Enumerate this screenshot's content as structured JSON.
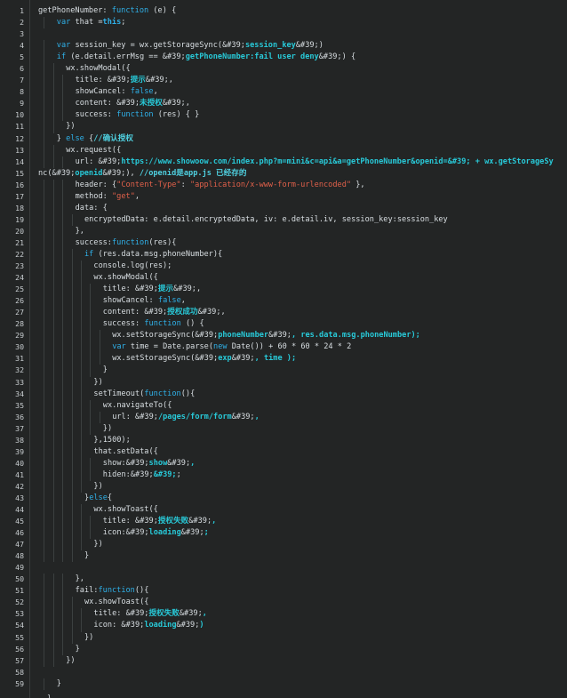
{
  "editor": {
    "theme_colors": {
      "background": "#232525",
      "keyword": "#2fb0e8",
      "string": "#28c9d8",
      "literal": "#e0604a",
      "text": "#d8dee2"
    },
    "lines": [
      {
        "n": "1",
        "indent": 0,
        "tokens": [
          [
            "t",
            "getPhoneNumber: "
          ],
          [
            "k",
            "function"
          ],
          [
            "t",
            " (e) {"
          ]
        ]
      },
      {
        "n": "2",
        "indent": 2,
        "tokens": [
          [
            "k",
            "var"
          ],
          [
            "t",
            " that ="
          ],
          [
            "kb",
            "this"
          ],
          [
            "t",
            ";"
          ]
        ]
      },
      {
        "n": "3",
        "indent": 0,
        "tokens": []
      },
      {
        "n": "4",
        "indent": 2,
        "tokens": [
          [
            "k",
            "var"
          ],
          [
            "t",
            " session_key = wx.getStorageSync(&#39;"
          ],
          [
            "s",
            "session_key"
          ],
          [
            "t",
            "&#39;)"
          ]
        ]
      },
      {
        "n": "5",
        "indent": 2,
        "tokens": [
          [
            "k",
            "if"
          ],
          [
            "t",
            " (e.detail.errMsg == &#39;"
          ],
          [
            "s",
            "getPhoneNumber:fail user deny"
          ],
          [
            "t",
            "&#39;) {"
          ]
        ]
      },
      {
        "n": "6",
        "indent": 3,
        "tokens": [
          [
            "t",
            "wx.showModal({"
          ]
        ]
      },
      {
        "n": "7",
        "indent": 4,
        "tokens": [
          [
            "t",
            "title: &#39;"
          ],
          [
            "s",
            "提示"
          ],
          [
            "t",
            "&#39;,"
          ]
        ]
      },
      {
        "n": "8",
        "indent": 4,
        "tokens": [
          [
            "t",
            "showCancel: "
          ],
          [
            "k",
            "false"
          ],
          [
            "t",
            ","
          ]
        ]
      },
      {
        "n": "9",
        "indent": 4,
        "tokens": [
          [
            "t",
            "content: &#39;"
          ],
          [
            "s",
            "未授权"
          ],
          [
            "t",
            "&#39;,"
          ]
        ]
      },
      {
        "n": "10",
        "indent": 4,
        "tokens": [
          [
            "t",
            "success: "
          ],
          [
            "k",
            "function"
          ],
          [
            "t",
            " (res) { }"
          ]
        ]
      },
      {
        "n": "11",
        "indent": 3,
        "tokens": [
          [
            "t",
            "})"
          ]
        ]
      },
      {
        "n": "12",
        "indent": 2,
        "tokens": [
          [
            "t",
            "} "
          ],
          [
            "k",
            "else"
          ],
          [
            "t",
            " {"
          ],
          [
            "c",
            "//确认授权"
          ]
        ]
      },
      {
        "n": "13",
        "indent": 3,
        "tokens": [
          [
            "t",
            "wx.request({"
          ]
        ]
      },
      {
        "n": "14",
        "indent": 4,
        "tokens": [
          [
            "t",
            "url: &#39;"
          ],
          [
            "s",
            "https://www.showoow.com/index.php?m=mini&c=api&a=getPhoneNumber&openid=&#39; + wx.getStorageSy"
          ]
        ]
      },
      {
        "n": "15",
        "indent": 0,
        "tokens": [
          [
            "t",
            "nc(&#39;"
          ],
          [
            "s",
            "openid"
          ],
          [
            "t",
            "&#39;), "
          ],
          [
            "c",
            "//openid是app.js 已经存的"
          ]
        ]
      },
      {
        "n": "16",
        "indent": 4,
        "tokens": [
          [
            "t",
            "header: {"
          ],
          [
            "r",
            "\"Content-Type\""
          ],
          [
            "t",
            ": "
          ],
          [
            "r",
            "\"application/x-www-form-urlencoded\""
          ],
          [
            "t",
            " },"
          ]
        ]
      },
      {
        "n": "17",
        "indent": 4,
        "tokens": [
          [
            "t",
            "method: "
          ],
          [
            "r",
            "\"get\""
          ],
          [
            "t",
            ","
          ]
        ]
      },
      {
        "n": "18",
        "indent": 4,
        "tokens": [
          [
            "t",
            "data: {"
          ]
        ]
      },
      {
        "n": "19",
        "indent": 5,
        "tokens": [
          [
            "t",
            "encryptedData: e.detail.encryptedData, iv: e.detail.iv, session_key:session_key"
          ]
        ]
      },
      {
        "n": "20",
        "indent": 4,
        "tokens": [
          [
            "t",
            "},"
          ]
        ]
      },
      {
        "n": "21",
        "indent": 4,
        "tokens": [
          [
            "t",
            "success:"
          ],
          [
            "k",
            "function"
          ],
          [
            "t",
            "(res){"
          ]
        ]
      },
      {
        "n": "22",
        "indent": 5,
        "tokens": [
          [
            "k",
            "if"
          ],
          [
            "t",
            " (res.data.msg.phoneNumber){"
          ]
        ]
      },
      {
        "n": "23",
        "indent": 6,
        "tokens": [
          [
            "t",
            "console.log(res);"
          ]
        ]
      },
      {
        "n": "24",
        "indent": 6,
        "tokens": [
          [
            "t",
            "wx.showModal({"
          ]
        ]
      },
      {
        "n": "25",
        "indent": 7,
        "tokens": [
          [
            "t",
            "title: &#39;"
          ],
          [
            "s",
            "提示"
          ],
          [
            "t",
            "&#39;,"
          ]
        ]
      },
      {
        "n": "26",
        "indent": 7,
        "tokens": [
          [
            "t",
            "showCancel: "
          ],
          [
            "k",
            "false"
          ],
          [
            "t",
            ","
          ]
        ]
      },
      {
        "n": "27",
        "indent": 7,
        "tokens": [
          [
            "t",
            "content: &#39;"
          ],
          [
            "s",
            "授权成功"
          ],
          [
            "t",
            "&#39;,"
          ]
        ]
      },
      {
        "n": "28",
        "indent": 7,
        "tokens": [
          [
            "t",
            "success: "
          ],
          [
            "k",
            "function"
          ],
          [
            "t",
            " () {"
          ]
        ]
      },
      {
        "n": "29",
        "indent": 8,
        "tokens": [
          [
            "t",
            "wx.setStorageSync(&#39;"
          ],
          [
            "s",
            "phoneNumber"
          ],
          [
            "t",
            "&#39;"
          ],
          [
            "s",
            ", res.data.msg.phoneNumber);"
          ]
        ]
      },
      {
        "n": "30",
        "indent": 8,
        "tokens": [
          [
            "k",
            "var"
          ],
          [
            "t",
            " time = Date.parse("
          ],
          [
            "k",
            "new"
          ],
          [
            "t",
            " Date()) + 60 * 60 * 24 * 2"
          ]
        ]
      },
      {
        "n": "31",
        "indent": 8,
        "tokens": [
          [
            "t",
            "wx.setStorageSync(&#39;"
          ],
          [
            "s",
            "exp"
          ],
          [
            "t",
            "&#39;"
          ],
          [
            "s",
            ", time );"
          ]
        ]
      },
      {
        "n": "32",
        "indent": 7,
        "tokens": [
          [
            "t",
            "}"
          ]
        ]
      },
      {
        "n": "33",
        "indent": 6,
        "tokens": [
          [
            "t",
            "})"
          ]
        ]
      },
      {
        "n": "34",
        "indent": 6,
        "tokens": [
          [
            "t",
            "setTimeout("
          ],
          [
            "k",
            "function"
          ],
          [
            "t",
            "(){"
          ]
        ]
      },
      {
        "n": "35",
        "indent": 7,
        "tokens": [
          [
            "t",
            "wx.navigateTo({"
          ]
        ]
      },
      {
        "n": "36",
        "indent": 8,
        "tokens": [
          [
            "t",
            "url: &#39;"
          ],
          [
            "s",
            "/pages/form/form"
          ],
          [
            "t",
            "&#39;"
          ],
          [
            "s",
            ","
          ]
        ]
      },
      {
        "n": "37",
        "indent": 7,
        "tokens": [
          [
            "t",
            "})"
          ]
        ]
      },
      {
        "n": "38",
        "indent": 6,
        "tokens": [
          [
            "t",
            "},1500);"
          ]
        ]
      },
      {
        "n": "39",
        "indent": 6,
        "tokens": [
          [
            "t",
            "that.setData({"
          ]
        ]
      },
      {
        "n": "40",
        "indent": 7,
        "tokens": [
          [
            "t",
            "show:&#39;"
          ],
          [
            "s",
            "show"
          ],
          [
            "t",
            "&#39;"
          ],
          [
            "s",
            ","
          ]
        ]
      },
      {
        "n": "41",
        "indent": 7,
        "tokens": [
          [
            "t",
            "hiden:&#39;"
          ],
          [
            "s",
            "&#39;"
          ],
          [
            "t",
            ";"
          ]
        ]
      },
      {
        "n": "42",
        "indent": 6,
        "tokens": [
          [
            "t",
            "})"
          ]
        ]
      },
      {
        "n": "43",
        "indent": 5,
        "tokens": [
          [
            "t",
            "}"
          ],
          [
            "k",
            "else"
          ],
          [
            "t",
            "{"
          ]
        ]
      },
      {
        "n": "44",
        "indent": 6,
        "tokens": [
          [
            "t",
            "wx.showToast({"
          ]
        ]
      },
      {
        "n": "45",
        "indent": 7,
        "tokens": [
          [
            "t",
            "title: &#39;"
          ],
          [
            "s",
            "授权失败"
          ],
          [
            "t",
            "&#39;"
          ],
          [
            "s",
            ","
          ]
        ]
      },
      {
        "n": "46",
        "indent": 7,
        "tokens": [
          [
            "t",
            "icon:&#39;"
          ],
          [
            "s",
            "loading"
          ],
          [
            "t",
            "&#39;"
          ],
          [
            "s",
            ";"
          ]
        ]
      },
      {
        "n": "47",
        "indent": 6,
        "tokens": [
          [
            "t",
            "})"
          ]
        ]
      },
      {
        "n": "48",
        "indent": 5,
        "tokens": [
          [
            "t",
            "}"
          ]
        ]
      },
      {
        "n": "49",
        "indent": 0,
        "tokens": []
      },
      {
        "n": "50",
        "indent": 4,
        "tokens": [
          [
            "t",
            "},"
          ]
        ]
      },
      {
        "n": "51",
        "indent": 4,
        "tokens": [
          [
            "t",
            "fail:"
          ],
          [
            "k",
            "function"
          ],
          [
            "t",
            "(){"
          ]
        ]
      },
      {
        "n": "52",
        "indent": 5,
        "tokens": [
          [
            "t",
            "wx.showToast({"
          ]
        ]
      },
      {
        "n": "53",
        "indent": 6,
        "tokens": [
          [
            "t",
            "title: &#39;"
          ],
          [
            "s",
            "授权失败"
          ],
          [
            "t",
            "&#39;"
          ],
          [
            "s",
            ","
          ]
        ]
      },
      {
        "n": "54",
        "indent": 6,
        "tokens": [
          [
            "t",
            "icon: &#39;"
          ],
          [
            "s",
            "loading"
          ],
          [
            "t",
            "&#39;"
          ],
          [
            "s",
            ")"
          ]
        ]
      },
      {
        "n": "55",
        "indent": 5,
        "tokens": [
          [
            "t",
            "})"
          ]
        ]
      },
      {
        "n": "56",
        "indent": 4,
        "tokens": [
          [
            "t",
            "}"
          ]
        ]
      },
      {
        "n": "57",
        "indent": 3,
        "tokens": [
          [
            "t",
            "})"
          ]
        ]
      },
      {
        "n": "58",
        "indent": 0,
        "tokens": []
      },
      {
        "n": "59",
        "indent": 2,
        "tokens": [
          [
            "t",
            "}"
          ]
        ]
      }
    ],
    "trailing_text": "},"
  }
}
